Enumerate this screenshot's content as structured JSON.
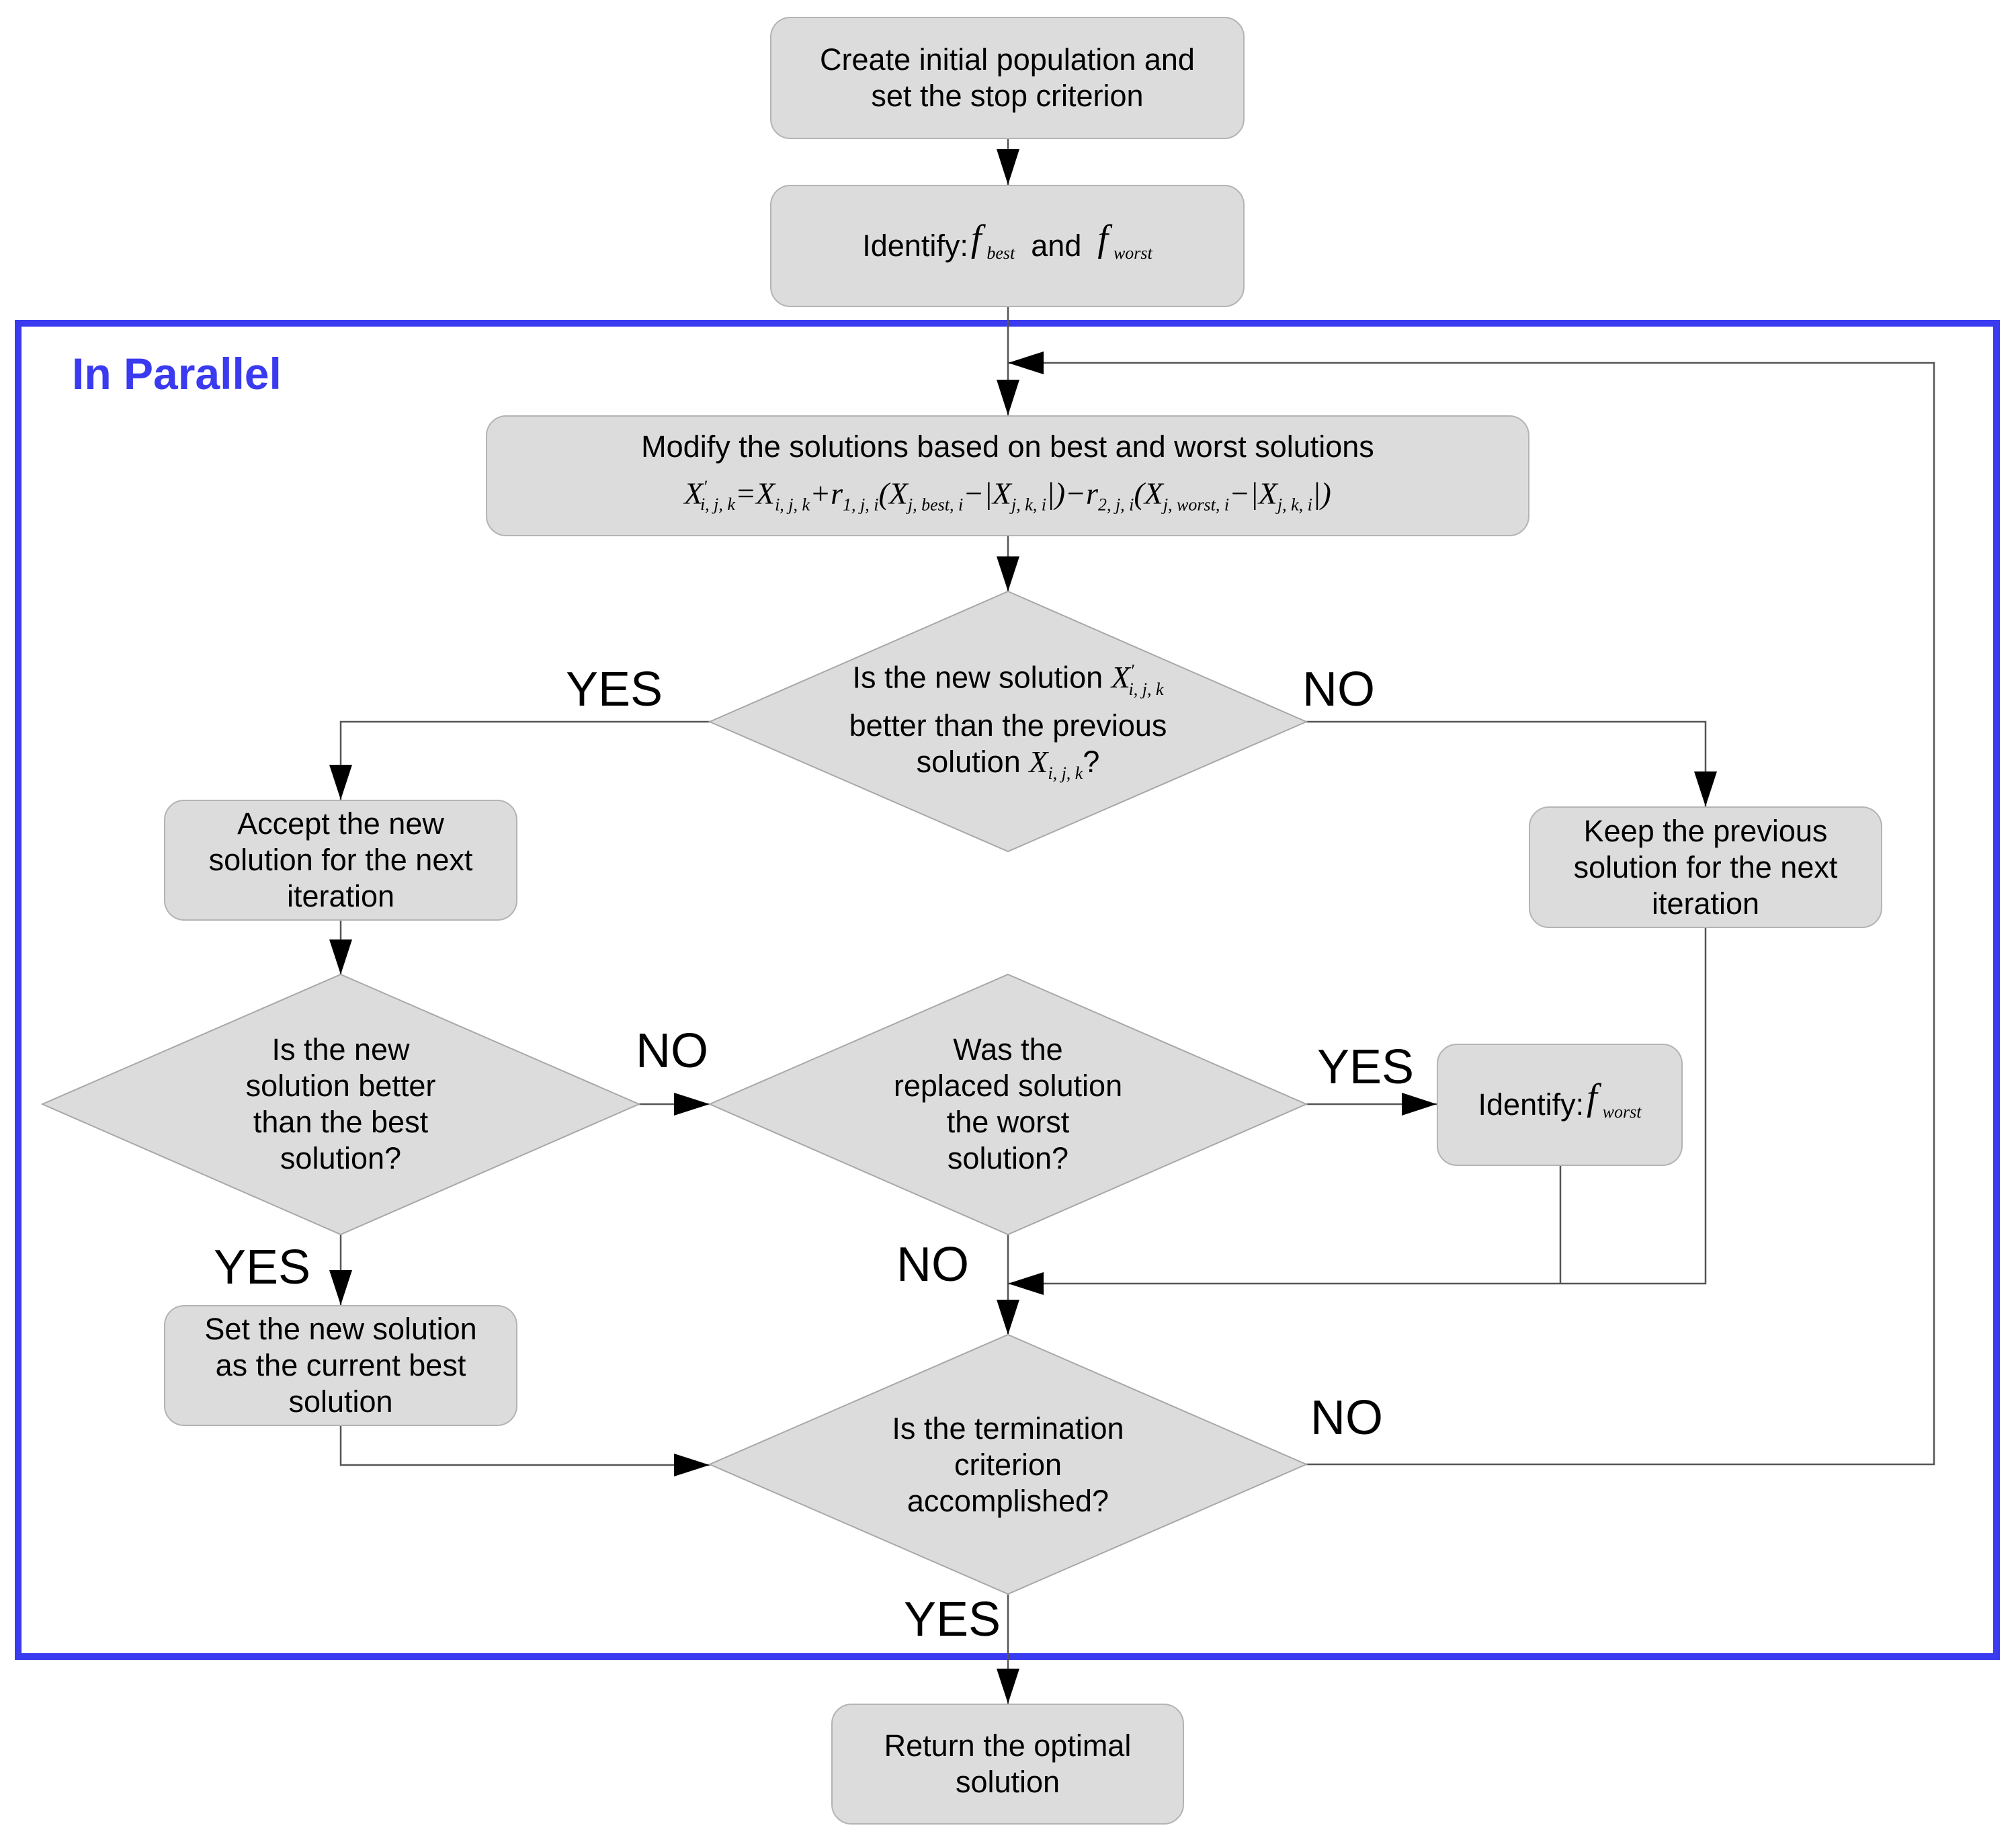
{
  "frame": {
    "label": "In Parallel",
    "color": "#3a3af0"
  },
  "nodes": {
    "start": {
      "line1": "Create initial population and",
      "line2": "set the stop criterion"
    },
    "identify_both": {
      "prefix": "Identify:",
      "f1": "f",
      "s1": "best",
      "mid": "and",
      "f2": "f",
      "s2": "worst"
    },
    "modify": {
      "title": "Modify the solutions based on best and worst solutions",
      "formula": "X'i,j,k = Xi,j,k + r1,j,i (Xj,best,i − |Xj,k,i|) − r2,j,i (Xj,worst,i − |Xj,k,i|)"
    },
    "decision_new_better": {
      "line1": "Is the new solution",
      "line2": "better than the previous",
      "line3": "solution",
      "var": "X",
      "sub": "i, j, k",
      "q": "?"
    },
    "accept": {
      "line1": "Accept the new",
      "line2": "solution for the next",
      "line3": "iteration"
    },
    "keep": {
      "line1": "Keep the previous",
      "line2": "solution for the next",
      "line3": "iteration"
    },
    "decision_best": {
      "line1": "Is the new",
      "line2": "solution better",
      "line3": "than the best",
      "line4": "solution?"
    },
    "decision_worst": {
      "line1": "Was the",
      "line2": "replaced solution",
      "line3": "the worst",
      "line4": "solution?"
    },
    "identify_worst": {
      "prefix": "Identify:",
      "f": "f",
      "sub": "worst"
    },
    "set_best": {
      "line1": "Set the new solution",
      "line2": "as the current best",
      "line3": "solution"
    },
    "decision_term": {
      "line1": "Is the termination",
      "line2": "criterion",
      "line3": "accomplished?"
    },
    "return": {
      "line1": "Return the optimal",
      "line2": "solution"
    }
  },
  "labels": {
    "yes1": "YES",
    "no1": "NO",
    "no2": "NO",
    "yes2": "YES",
    "yes3": "YES",
    "no3": "NO",
    "no4": "NO",
    "yes4": "YES"
  }
}
